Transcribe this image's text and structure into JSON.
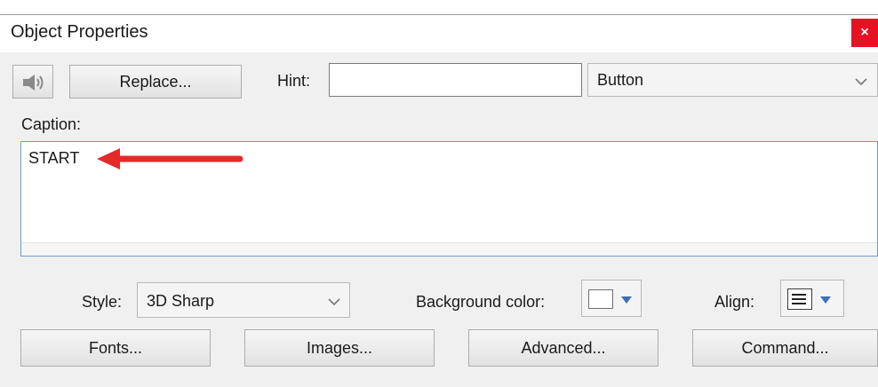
{
  "window": {
    "title": "Object Properties",
    "close_label": "×"
  },
  "toolbar": {
    "replace_label": "Replace...",
    "hint_label": "Hint:",
    "hint_value": "",
    "type_value": "Button"
  },
  "caption": {
    "label": "Caption:",
    "value": "START"
  },
  "style_row": {
    "style_label": "Style:",
    "style_value": "3D Sharp",
    "bg_label": "Background color:",
    "align_label": "Align:"
  },
  "buttons": {
    "fonts": "Fonts...",
    "images": "Images...",
    "advanced": "Advanced...",
    "command": "Command..."
  },
  "colors": {
    "accent_arrow": "#e32b2b",
    "close_bg": "#e81123",
    "focus_border": "#6f9bd1",
    "dropdown_arrow": "#3c6fb4"
  }
}
